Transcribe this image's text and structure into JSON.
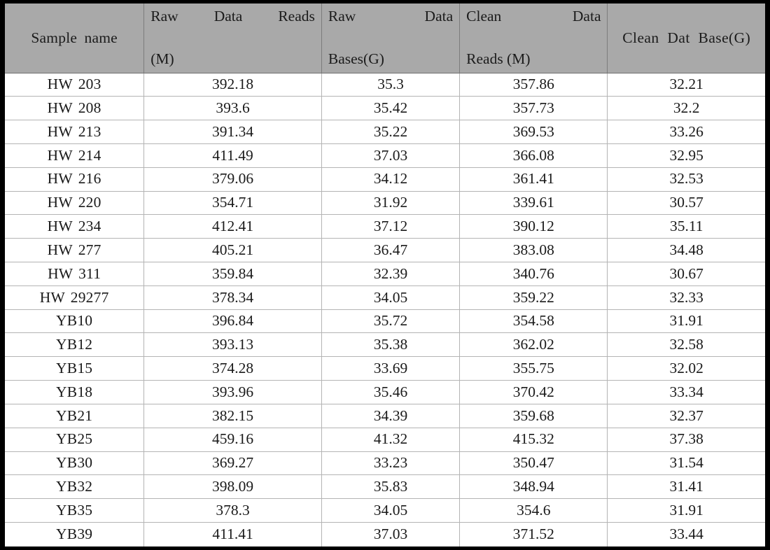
{
  "table": {
    "columns": [
      {
        "id": "sample_name",
        "label": "Sample name",
        "align": "center",
        "layout": "single-line"
      },
      {
        "id": "raw_data_reads_m",
        "label": "Raw Data Reads (M)",
        "line1": "Raw Data Reads",
        "line2": "(M)",
        "align": "justify",
        "layout": "two-line-justified"
      },
      {
        "id": "raw_data_bases_g",
        "label": "Raw Data Bases(G)",
        "line1": "Raw Data",
        "line2": "Bases(G)",
        "align": "justify",
        "layout": "two-line-justified"
      },
      {
        "id": "clean_data_reads_m",
        "label": "Clean Data Reads (M)",
        "line1": "Clean Data",
        "line2": "Reads (M)",
        "align": "justify",
        "layout": "two-line-justified"
      },
      {
        "id": "clean_dat_base_g",
        "label": "Clean Dat Base(G)",
        "align": "center",
        "layout": "single-line"
      }
    ],
    "rows": [
      {
        "sample_name": "HW 203",
        "raw_data_reads_m": "392.18",
        "raw_data_bases_g": "35.3",
        "clean_data_reads_m": "357.86",
        "clean_dat_base_g": "32.21"
      },
      {
        "sample_name": "HW 208",
        "raw_data_reads_m": "393.6",
        "raw_data_bases_g": "35.42",
        "clean_data_reads_m": "357.73",
        "clean_dat_base_g": "32.2"
      },
      {
        "sample_name": "HW 213",
        "raw_data_reads_m": "391.34",
        "raw_data_bases_g": "35.22",
        "clean_data_reads_m": "369.53",
        "clean_dat_base_g": "33.26"
      },
      {
        "sample_name": "HW 214",
        "raw_data_reads_m": "411.49",
        "raw_data_bases_g": "37.03",
        "clean_data_reads_m": "366.08",
        "clean_dat_base_g": "32.95"
      },
      {
        "sample_name": "HW 216",
        "raw_data_reads_m": "379.06",
        "raw_data_bases_g": "34.12",
        "clean_data_reads_m": "361.41",
        "clean_dat_base_g": "32.53"
      },
      {
        "sample_name": "HW 220",
        "raw_data_reads_m": "354.71",
        "raw_data_bases_g": "31.92",
        "clean_data_reads_m": "339.61",
        "clean_dat_base_g": "30.57"
      },
      {
        "sample_name": "HW 234",
        "raw_data_reads_m": "412.41",
        "raw_data_bases_g": "37.12",
        "clean_data_reads_m": "390.12",
        "clean_dat_base_g": "35.11"
      },
      {
        "sample_name": "HW 277",
        "raw_data_reads_m": "405.21",
        "raw_data_bases_g": "36.47",
        "clean_data_reads_m": "383.08",
        "clean_dat_base_g": "34.48"
      },
      {
        "sample_name": "HW 311",
        "raw_data_reads_m": "359.84",
        "raw_data_bases_g": "32.39",
        "clean_data_reads_m": "340.76",
        "clean_dat_base_g": "30.67"
      },
      {
        "sample_name": "HW 29277",
        "raw_data_reads_m": "378.34",
        "raw_data_bases_g": "34.05",
        "clean_data_reads_m": "359.22",
        "clean_dat_base_g": "32.33"
      },
      {
        "sample_name": "YB10",
        "raw_data_reads_m": "396.84",
        "raw_data_bases_g": "35.72",
        "clean_data_reads_m": "354.58",
        "clean_dat_base_g": "31.91"
      },
      {
        "sample_name": "YB12",
        "raw_data_reads_m": "393.13",
        "raw_data_bases_g": "35.38",
        "clean_data_reads_m": "362.02",
        "clean_dat_base_g": "32.58"
      },
      {
        "sample_name": "YB15",
        "raw_data_reads_m": "374.28",
        "raw_data_bases_g": "33.69",
        "clean_data_reads_m": "355.75",
        "clean_dat_base_g": "32.02"
      },
      {
        "sample_name": "YB18",
        "raw_data_reads_m": "393.96",
        "raw_data_bases_g": "35.46",
        "clean_data_reads_m": "370.42",
        "clean_dat_base_g": "33.34"
      },
      {
        "sample_name": "YB21",
        "raw_data_reads_m": "382.15",
        "raw_data_bases_g": "34.39",
        "clean_data_reads_m": "359.68",
        "clean_dat_base_g": "32.37"
      },
      {
        "sample_name": "YB25",
        "raw_data_reads_m": "459.16",
        "raw_data_bases_g": "41.32",
        "clean_data_reads_m": "415.32",
        "clean_dat_base_g": "37.38"
      },
      {
        "sample_name": "YB30",
        "raw_data_reads_m": "369.27",
        "raw_data_bases_g": "33.23",
        "clean_data_reads_m": "350.47",
        "clean_dat_base_g": "31.54"
      },
      {
        "sample_name": "YB32",
        "raw_data_reads_m": "398.09",
        "raw_data_bases_g": "35.83",
        "clean_data_reads_m": "348.94",
        "clean_dat_base_g": "31.41"
      },
      {
        "sample_name": "YB35",
        "raw_data_reads_m": "378.3",
        "raw_data_bases_g": "34.05",
        "clean_data_reads_m": "354.6",
        "clean_dat_base_g": "31.91"
      },
      {
        "sample_name": "YB39",
        "raw_data_reads_m": "411.41",
        "raw_data_bases_g": "37.03",
        "clean_data_reads_m": "371.52",
        "clean_dat_base_g": "33.44"
      }
    ],
    "row_count": 20,
    "column_count": 5,
    "colors": {
      "header_background": "#a9a9a9",
      "header_text": "#1b1b1b",
      "body_background": "#ffffff",
      "body_text": "#1a1a1a",
      "inner_grid_line": "#b4b4b4",
      "outer_border": "#000000"
    }
  }
}
